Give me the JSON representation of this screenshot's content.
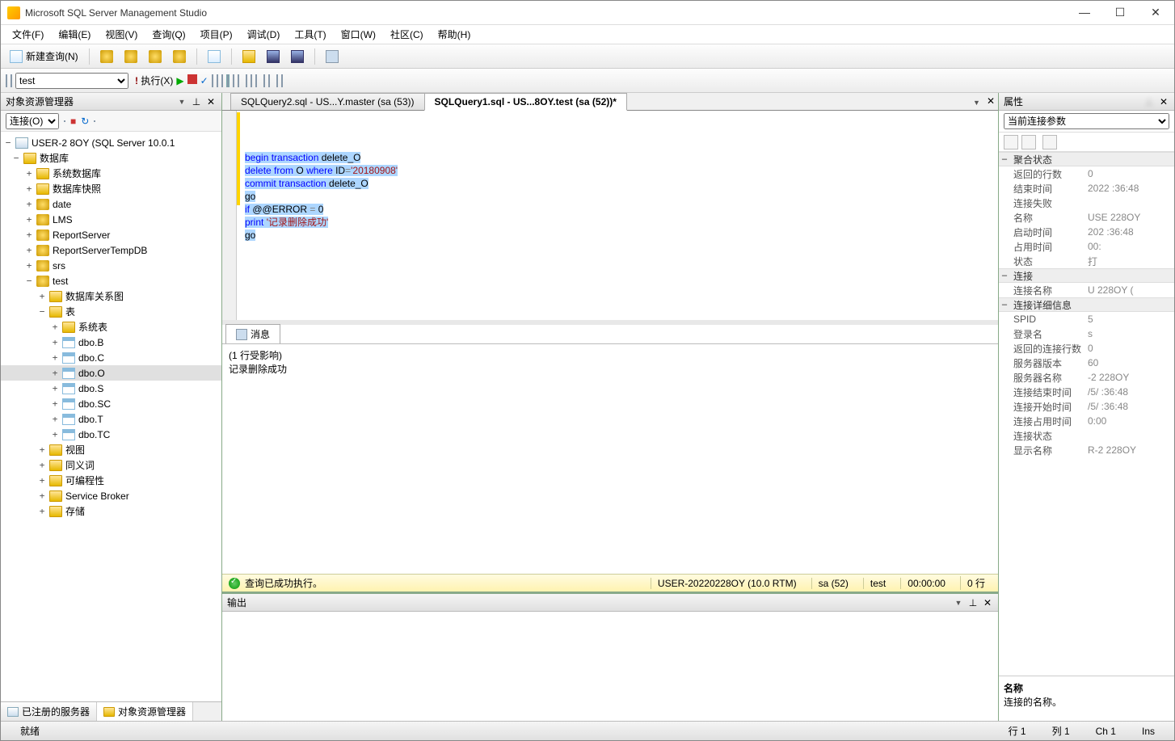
{
  "app": {
    "title": "Microsoft SQL Server Management Studio"
  },
  "menu": [
    "文件(F)",
    "编辑(E)",
    "视图(V)",
    "查询(Q)",
    "项目(P)",
    "调试(D)",
    "工具(T)",
    "窗口(W)",
    "社区(C)",
    "帮助(H)"
  ],
  "toolbar1": {
    "new_query": "新建查询(N)"
  },
  "toolbar2": {
    "db_select": "test",
    "execute": "执行(X)"
  },
  "object_explorer": {
    "title": "对象资源管理器",
    "connect_label": "连接(O)",
    "server": "USER-2            8OY (SQL Server 10.0.1",
    "databases": "数据库",
    "sys_db": "系统数据库",
    "db_snap": "数据库快照",
    "dbs": [
      "date",
      "LMS",
      "ReportServer",
      "ReportServerTempDB",
      "srs",
      "test"
    ],
    "test_children": {
      "diagrams": "数据库关系图",
      "tables": "表",
      "sys_tables": "系统表",
      "table_list": [
        "dbo.B",
        "dbo.C",
        "dbo.O",
        "dbo.S",
        "dbo.SC",
        "dbo.T",
        "dbo.TC"
      ],
      "views": "视图",
      "synonyms": "同义词",
      "programmability": "可编程性",
      "service_broker": "Service Broker",
      "storage": "存储"
    }
  },
  "left_tabs": {
    "registered": "已注册的服务器",
    "explorer": "对象资源管理器"
  },
  "tabs": [
    {
      "label": "SQLQuery2.sql - US...Y.master (sa (53))",
      "active": false
    },
    {
      "label": "SQLQuery1.sql - US...8OY.test (sa (52))*",
      "active": true
    }
  ],
  "code": {
    "l1a": "begin",
    "l1b": " transaction",
    "l1c": " delete_O",
    "l2a": "delete",
    "l2b": " from",
    "l2c": " O ",
    "l2d": "where",
    "l2e": " ID",
    "l2f": "=",
    "l2g": "'20180908'",
    "l3a": "commit",
    "l3b": " transaction",
    "l3c": " delete_O",
    "l4": "go",
    "l5a": "if",
    "l5b": " @@ERROR ",
    "l5c": "=",
    "l5d": " 0",
    "l6a": "print",
    "l6b": " ",
    "l6c": "'记录删除成功'",
    "l7": "go"
  },
  "messages": {
    "tab": "消息",
    "line1": "(1 行受影响)",
    "line2": "记录删除成功"
  },
  "query_status": {
    "text": "查询已成功执行。",
    "server": "USER-20220228OY (10.0 RTM)",
    "user": "sa (52)",
    "db": "test",
    "time": "00:00:00",
    "rows": "0 行"
  },
  "properties": {
    "title": "属性",
    "selector": "当前连接参数",
    "cat1": "聚合状态",
    "rows1": [
      {
        "k": "返回的行数",
        "v": "0"
      },
      {
        "k": "结束时间",
        "v": "2022             :36:48"
      },
      {
        "k": "连接失败",
        "v": ""
      },
      {
        "k": "名称",
        "v": "USE         228OY"
      },
      {
        "k": "启动时间",
        "v": "202            :36:48"
      },
      {
        "k": "占用时间",
        "v": "00:"
      },
      {
        "k": "状态",
        "v": "打"
      }
    ],
    "cat2": "连接",
    "rows2": [
      {
        "k": "连接名称",
        "v": "U               228OY ("
      }
    ],
    "cat3": "连接详细信息",
    "rows3": [
      {
        "k": "SPID",
        "v": "5"
      },
      {
        "k": "登录名",
        "v": "s"
      },
      {
        "k": "返回的连接行数",
        "v": "0"
      },
      {
        "k": "服务器版本",
        "v": "          60"
      },
      {
        "k": "服务器名称",
        "v": "   -2         228OY"
      },
      {
        "k": "连接结束时间",
        "v": "  /5/         :36:48"
      },
      {
        "k": "连接开始时间",
        "v": "  /5/         :36:48"
      },
      {
        "k": "连接占用时间",
        "v": "  0:00"
      },
      {
        "k": "连接状态",
        "v": ""
      },
      {
        "k": "显示名称",
        "v": "  R-2         228OY"
      }
    ],
    "desc_title": "名称",
    "desc_text": "连接的名称。"
  },
  "output": {
    "title": "输出"
  },
  "footer": {
    "ready": "就绪",
    "line": "行 1",
    "col": "列 1",
    "ch": "Ch 1",
    "ins": "Ins"
  }
}
